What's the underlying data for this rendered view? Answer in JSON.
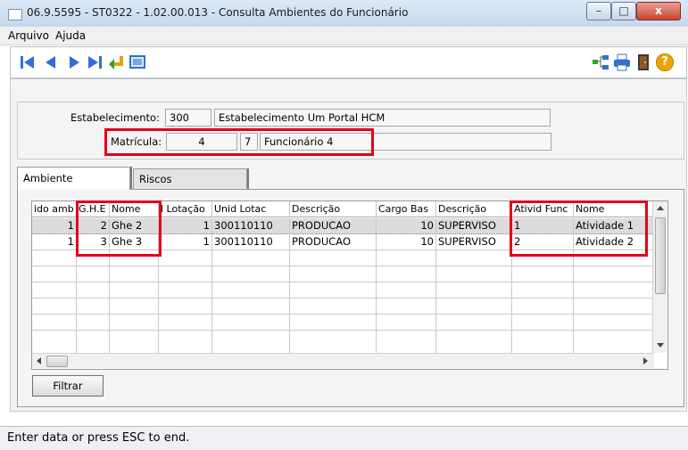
{
  "window": {
    "title": "06.9.5595 - ST0322 - 1.02.00.013 - Consulta Ambientes do Funcionário",
    "minimize": "–",
    "maximize": "□",
    "close": "x"
  },
  "menu": {
    "items": [
      "Arquivo",
      "Ajuda"
    ]
  },
  "toolbar": {
    "nav_icons": [
      "first-record-icon",
      "previous-record-icon",
      "next-record-icon",
      "last-record-icon",
      "return-icon",
      "zoom-screen-icon"
    ],
    "right_icons": [
      "hierarchy-icon",
      "print-icon",
      "exit-door-icon",
      "help-icon"
    ],
    "help_glyph": "?"
  },
  "header": {
    "estabelecimento_label": "Estabelecimento:",
    "estabelecimento_code": "300",
    "estabelecimento_name": "Estabelecimento Um Portal HCM",
    "matricula_label": "Matrícula:",
    "matricula_value": "4",
    "funcionario_code": "7",
    "funcionario_name": "Funcionário 4"
  },
  "tabs": [
    "Ambiente",
    "Riscos"
  ],
  "grid": {
    "headers": [
      "ido amb",
      "G.H.E",
      "Nome",
      "l Lotação",
      "Unid Lotac",
      "Descrição",
      "Cargo Bas",
      "Descrição",
      "Ativid Func",
      "Nome"
    ],
    "rows": [
      [
        "1",
        "2",
        "Ghe 2",
        "1",
        "300110110",
        "PRODUCAO",
        "10",
        "SUPERVISO",
        "1",
        "Atividade 1"
      ],
      [
        "1",
        "3",
        "Ghe 3",
        "1",
        "300110110",
        "PRODUCAO",
        "10",
        "SUPERVISO",
        "2",
        "Atividade 2"
      ]
    ]
  },
  "buttons": {
    "filtrar": "Filtrar"
  },
  "status": {
    "text": "Enter data or press ESC to end."
  },
  "colors": {
    "highlight_red": "#e2001a",
    "nav_blue": "#2f6fd6"
  }
}
